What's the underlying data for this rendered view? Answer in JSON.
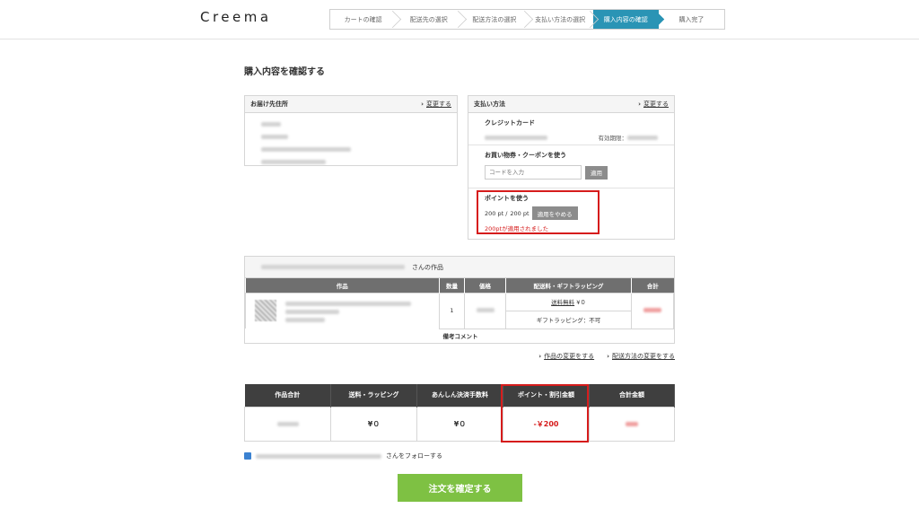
{
  "header": {
    "logo": "Creema",
    "steps": [
      "カートの確認",
      "配送先の選択",
      "配送方法の選択",
      "支払い方法の選択",
      "購入内容の確認",
      "購入完了"
    ],
    "active_step": 4
  },
  "page_title": "購入内容を確認する",
  "address": {
    "title": "お届け先住所",
    "change_link": "変更する"
  },
  "payment": {
    "title": "支払い方法",
    "change_link": "変更する",
    "card_title": "クレジットカード",
    "expiry_label": "有効期限：",
    "coupon_title": "お買い物券・クーポンを使う",
    "coupon_placeholder": "コードを入力",
    "coupon_apply": "適用",
    "point_title": "ポイントを使う",
    "point_value": "200 pt /",
    "point_max": "200 pt",
    "point_cancel": "適用をやめる",
    "point_message": "200ptが適用されました"
  },
  "shop": {
    "suffix": "さんの作品",
    "columns": [
      "作品",
      "数量",
      "価格",
      "配送料・ギフトラッピング",
      "合計"
    ],
    "quantity": "1",
    "shipping_link": "送料無料",
    "shipping_value": "¥０",
    "gift": "ギフトラッピング：不可",
    "comment": "備考コメント"
  },
  "links": {
    "change_item": "作品の変更をする",
    "change_shipping": "配送方法の変更をする"
  },
  "summary": {
    "headers": [
      "作品合計",
      "送料・ラッピング",
      "あんしん決済手数料",
      "ポイント・割引金額",
      "合計金額"
    ],
    "shipping": "¥０",
    "fee": "¥０",
    "discount": "-￥200"
  },
  "follow_suffix": "さんをフォローする",
  "confirm_button": "注文を確定する",
  "colors": {
    "accent_step": "#2a94b5",
    "highlight": "#d61c1c",
    "confirm": "#7ec143"
  }
}
